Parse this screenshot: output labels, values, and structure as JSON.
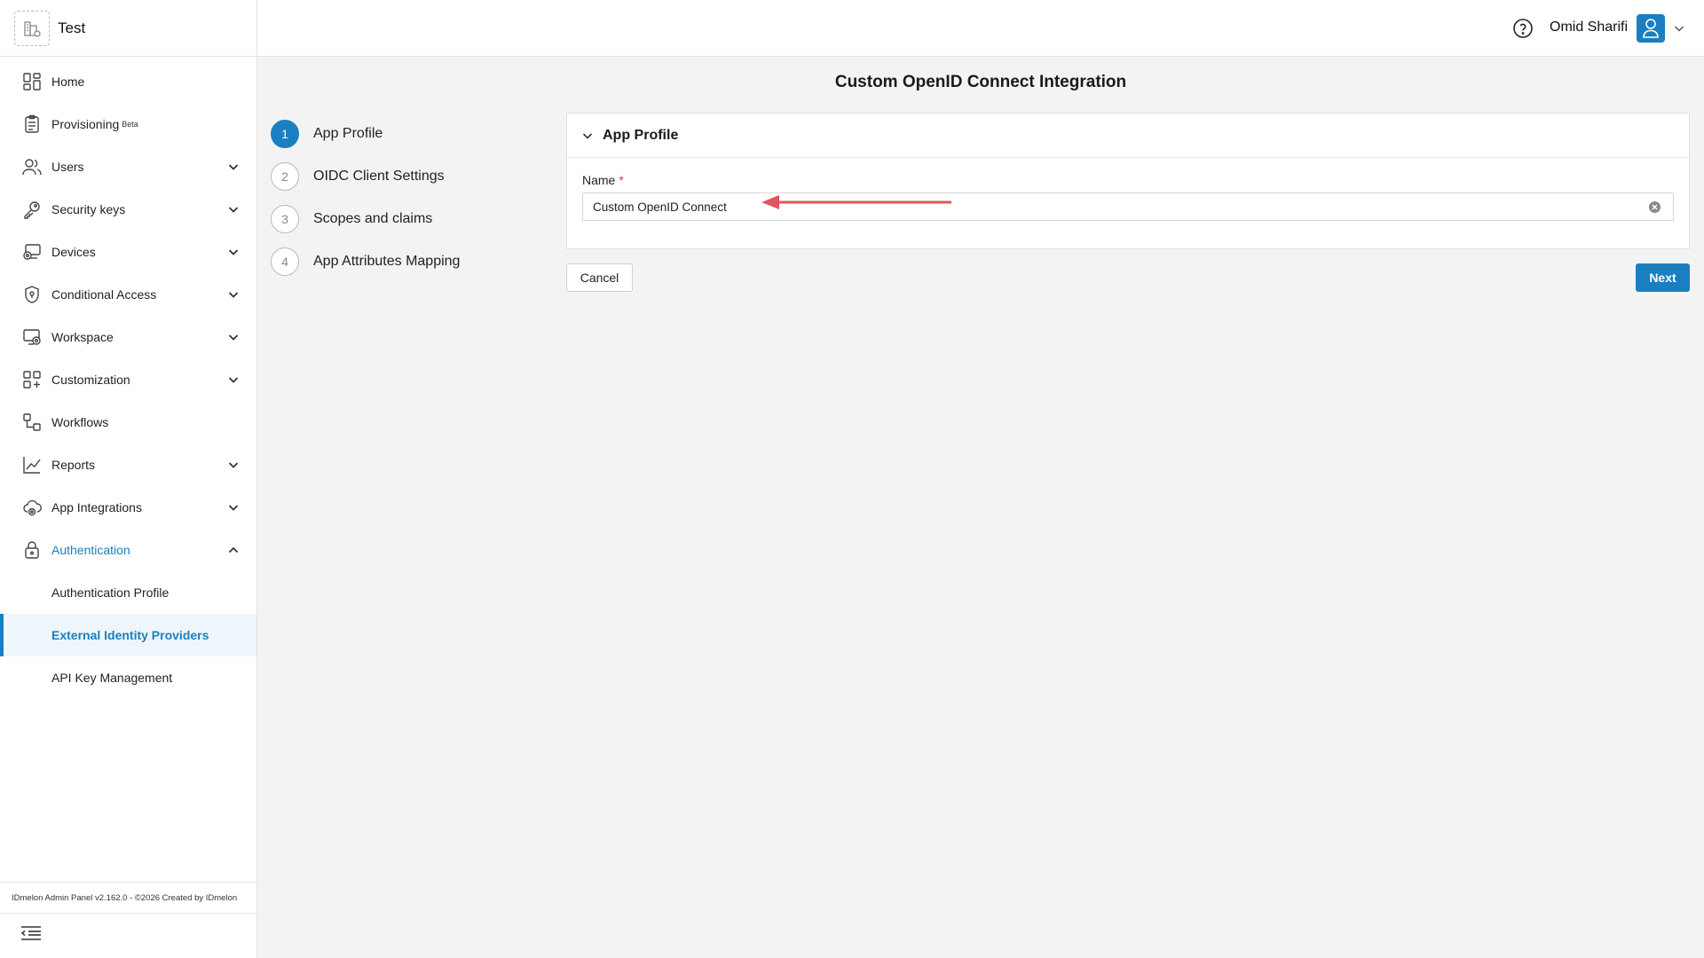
{
  "org": {
    "name": "Test"
  },
  "sidebar": {
    "items": [
      {
        "label": "Home"
      },
      {
        "label": "Provisioning",
        "badge": "Beta"
      },
      {
        "label": "Users"
      },
      {
        "label": "Security keys"
      },
      {
        "label": "Devices"
      },
      {
        "label": "Conditional Access"
      },
      {
        "label": "Workspace"
      },
      {
        "label": "Customization"
      },
      {
        "label": "Workflows"
      },
      {
        "label": "Reports"
      },
      {
        "label": "App Integrations"
      },
      {
        "label": "Authentication"
      }
    ],
    "sub_items": [
      {
        "label": "Authentication Profile"
      },
      {
        "label": "External Identity Providers"
      },
      {
        "label": "API Key Management"
      }
    ],
    "footer": "IDmelon Admin Panel v2.162.0 - ©2026 Created by IDmelon"
  },
  "header": {
    "user_name": "Omid Sharifi"
  },
  "main": {
    "title": "Custom OpenID Connect Integration",
    "steps": [
      {
        "number": "1",
        "label": "App Profile"
      },
      {
        "number": "2",
        "label": "OIDC Client Settings"
      },
      {
        "number": "3",
        "label": "Scopes and claims"
      },
      {
        "number": "4",
        "label": "App Attributes Mapping"
      }
    ],
    "section": {
      "title": "App Profile",
      "name_label": "Name",
      "required_mark": "*",
      "name_value": "Custom OpenID Connect"
    },
    "cancel_label": "Cancel",
    "next_label": "Next"
  },
  "colors": {
    "accent": "#1a7fc1",
    "annotation_arrow": "#e0555a",
    "required": "#d9363e"
  }
}
